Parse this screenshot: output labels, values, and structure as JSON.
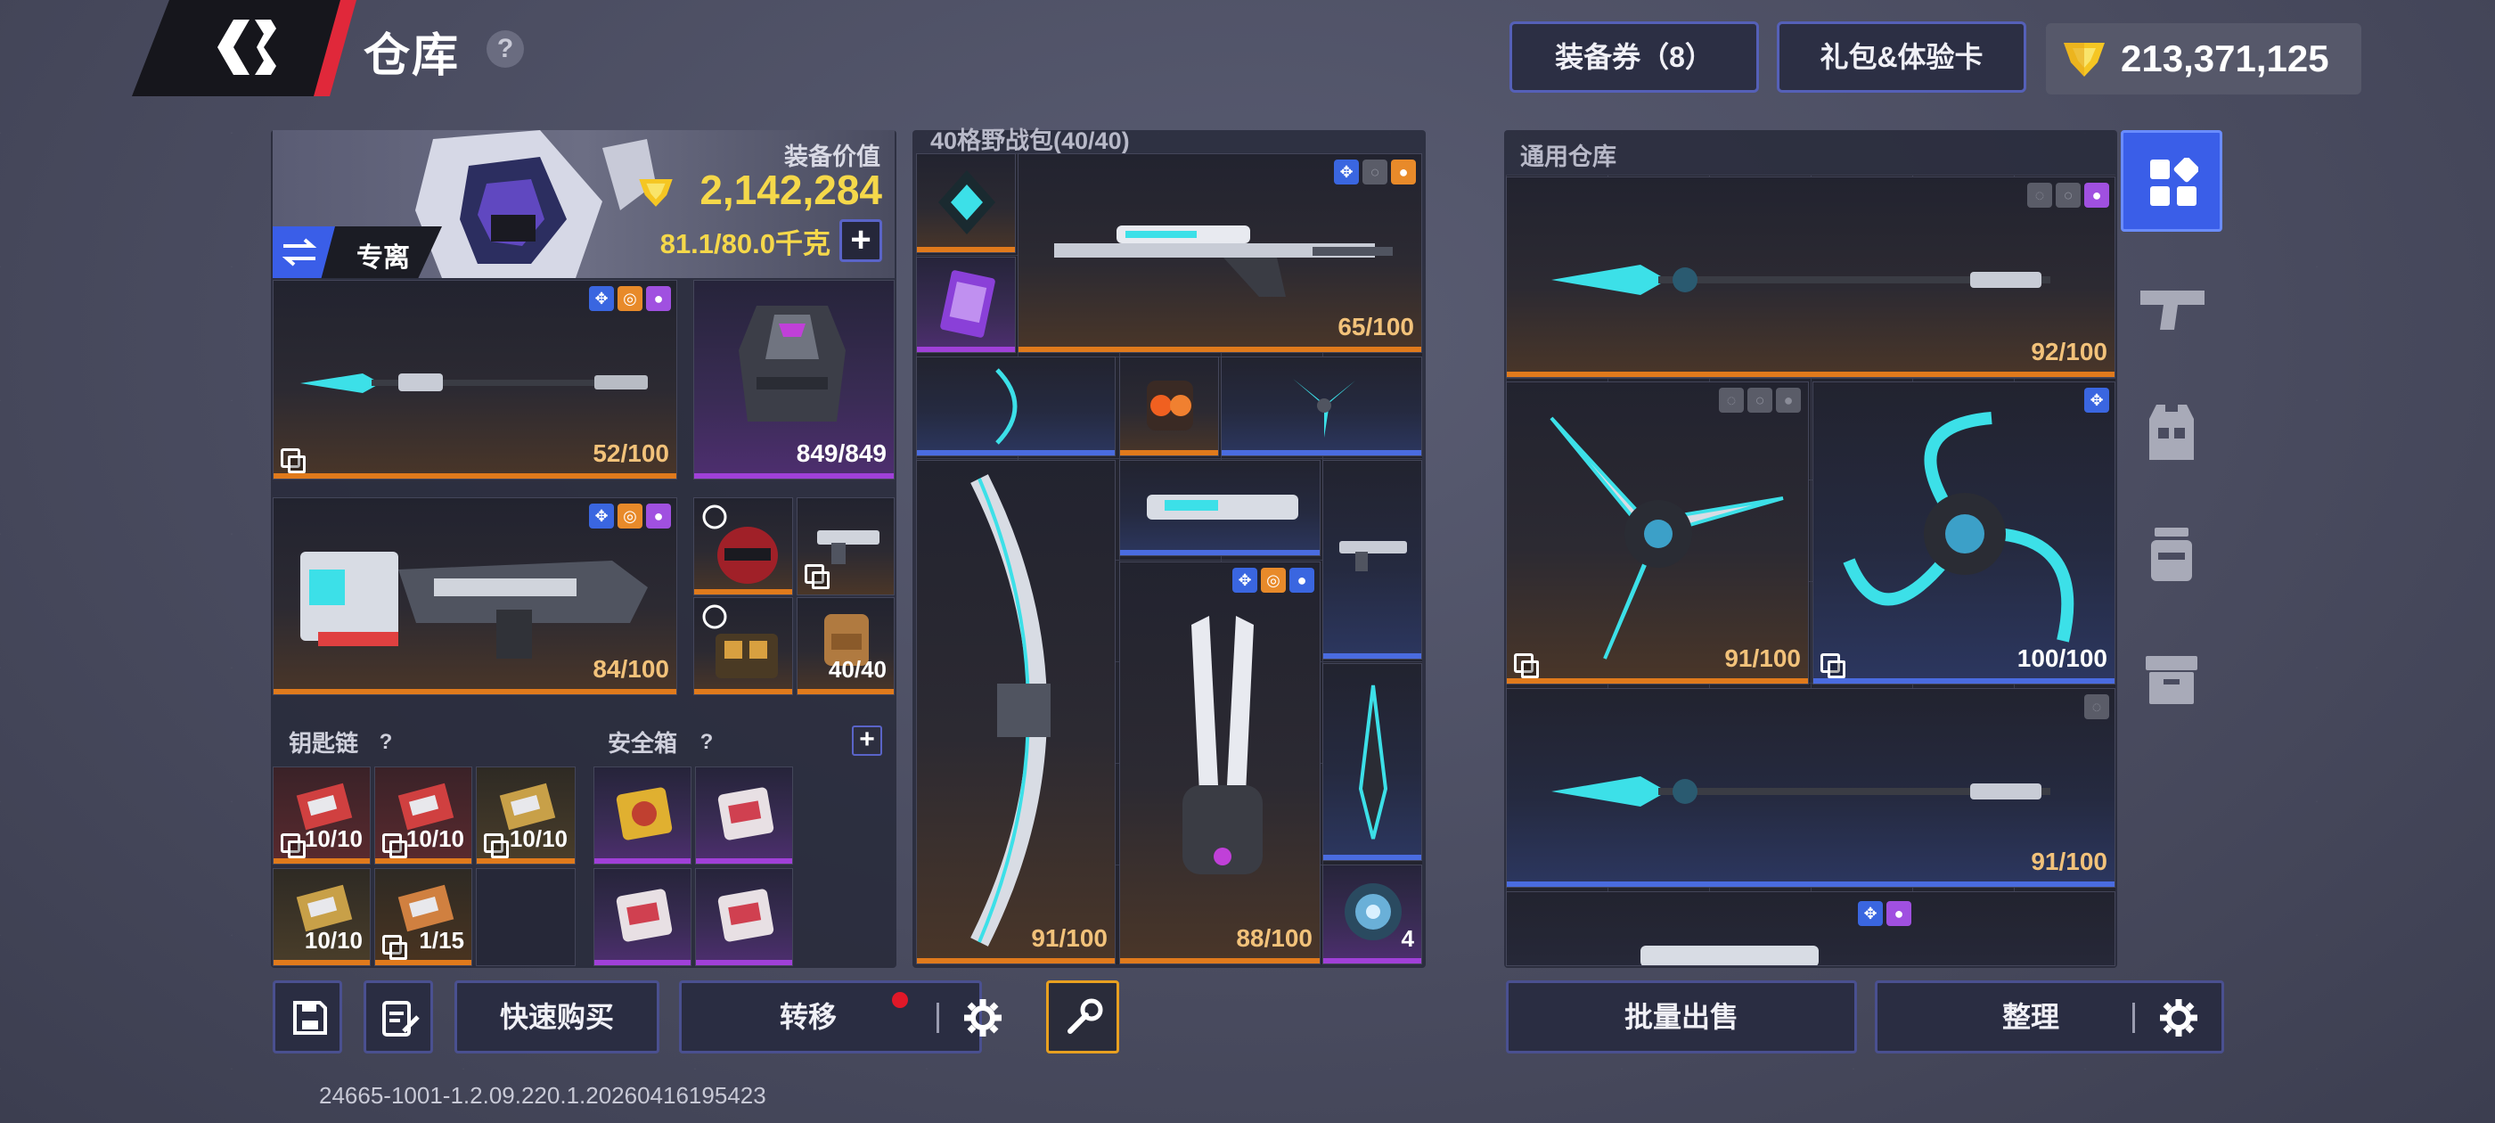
{
  "header": {
    "title": "仓库",
    "help": "?",
    "equip_voucher_btn": "装备券（8）",
    "gift_btn": "礼包&体验卡",
    "currency_amount": "213,371,125"
  },
  "loadout": {
    "value_label": "装备价值",
    "value": "2,142,284",
    "weight": "81.1/80.0千克",
    "mode_label": "专离",
    "slots": [
      {
        "name": "spear-primary",
        "durability": "52/100"
      },
      {
        "name": "armor-vest",
        "durability": "849/849"
      },
      {
        "name": "heavy-rifle",
        "durability": "84/100"
      },
      {
        "name": "helmet"
      },
      {
        "name": "pistol"
      },
      {
        "name": "rig"
      },
      {
        "name": "backpack",
        "durability": "40/40"
      }
    ]
  },
  "keychain": {
    "label": "钥匙链",
    "items": [
      "10/10",
      "10/10",
      "10/10",
      "10/10",
      "1/15"
    ]
  },
  "safebox": {
    "label": "安全箱"
  },
  "backpack": {
    "title": "40格野战包(40/40)",
    "items": [
      {
        "name": "sniper-rifle",
        "durability": "65/100"
      },
      {
        "name": "greatbow",
        "durability": "91/100"
      },
      {
        "name": "claw-weapon",
        "durability": "88/100"
      },
      {
        "name": "orb-consumable",
        "count": "4"
      }
    ]
  },
  "storage": {
    "title": "通用仓库",
    "items": [
      {
        "name": "spear-1",
        "durability": "92/100"
      },
      {
        "name": "shuriken-1",
        "durability": "91/100"
      },
      {
        "name": "shuriken-2",
        "durability": "100/100"
      },
      {
        "name": "spear-2",
        "durability": "91/100"
      }
    ]
  },
  "side_tabs": [
    "all-items",
    "weapons",
    "armor",
    "consumables",
    "misc"
  ],
  "bottom": {
    "quick_buy": "快速购买",
    "transfer": "转移",
    "bulk_sell": "批量出售",
    "sort": "整理"
  },
  "version": "24665-1001-1.2.09.220.1.20260416195423",
  "colors": {
    "orange_bar": "#e07a1c",
    "blue_bar": "#4a6ce0",
    "purple_bar": "#a040d8",
    "gold_value": "#f5d84a",
    "active_tab": "#3a5ee8",
    "red_accent": "#e0283a"
  }
}
